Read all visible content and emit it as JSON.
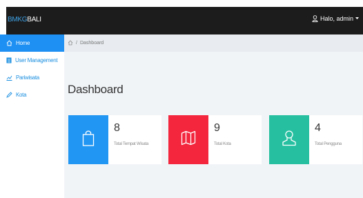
{
  "app": {
    "brand_prefix": "BMKG",
    "brand_suffix": "BALI"
  },
  "header": {
    "user_label": "Halo, admin",
    "user_icon": "user-icon",
    "caret_icon": "caret-down-icon"
  },
  "sidebar": {
    "items": [
      {
        "label": "Home",
        "icon": "home-icon",
        "active": true
      },
      {
        "label": "User Management",
        "icon": "list-icon",
        "active": false
      },
      {
        "label": "Pariwisata",
        "icon": "chart-icon",
        "active": false
      },
      {
        "label": "Kota",
        "icon": "pencil-icon",
        "active": false
      }
    ]
  },
  "breadcrumb": {
    "home_icon": "home-icon",
    "separator": "/",
    "current": "Dashboard"
  },
  "page": {
    "title": "Dashboard"
  },
  "stats": [
    {
      "value": "8",
      "label": "Total Tempat Wisata",
      "icon": "shopping-bag-icon",
      "color": "#2196f3"
    },
    {
      "value": "9",
      "label": "Total Kota",
      "icon": "map-icon",
      "color": "#f3263d"
    },
    {
      "value": "4",
      "label": "Total Pengguna",
      "icon": "user-icon",
      "color": "#26c0a0"
    }
  ],
  "colors": {
    "topbar": "#1c1c1c",
    "accent": "#1e90f3",
    "background": "#f1f4f7"
  }
}
